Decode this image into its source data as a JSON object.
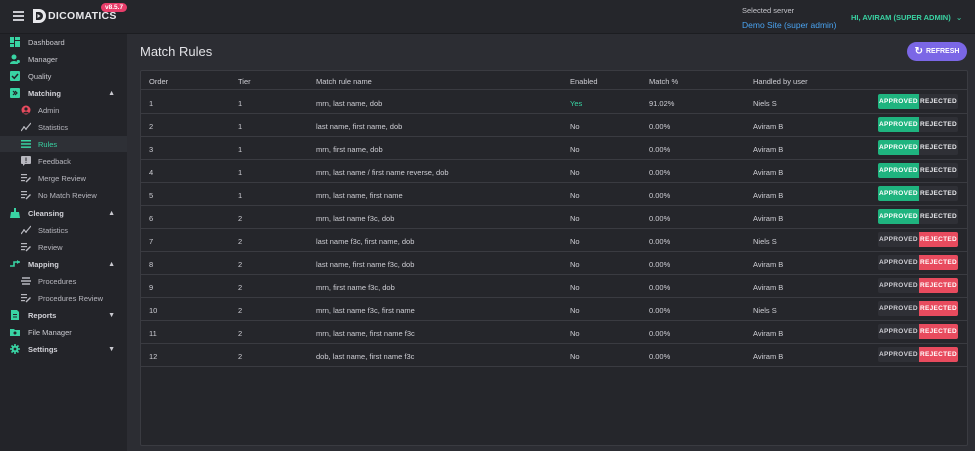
{
  "header": {
    "logo_text": "DICOMATICS",
    "version": "v8.5.7",
    "server_caption": "Selected server",
    "server_name": "Demo Site (super admin)",
    "user_greeting": "HI, AVIRAM (SUPER ADMIN)"
  },
  "sidebar": {
    "items": [
      {
        "label": "Dashboard",
        "icon": "dashboard-icon"
      },
      {
        "label": "Manager",
        "icon": "manager-icon"
      },
      {
        "label": "Quality",
        "icon": "quality-icon"
      },
      {
        "label": "Matching",
        "icon": "matching-icon",
        "expanded": true
      },
      {
        "label": "Admin",
        "icon": "admin-icon"
      },
      {
        "label": "Statistics",
        "icon": "statistics-icon"
      },
      {
        "label": "Rules",
        "icon": "rules-icon",
        "active": true
      },
      {
        "label": "Feedback",
        "icon": "feedback-icon"
      },
      {
        "label": "Merge Review",
        "icon": "review-icon"
      },
      {
        "label": "No Match Review",
        "icon": "review-icon"
      },
      {
        "label": "Cleansing",
        "icon": "cleansing-icon",
        "expanded": true
      },
      {
        "label": "Statistics",
        "icon": "statistics-icon"
      },
      {
        "label": "Review",
        "icon": "review-icon"
      },
      {
        "label": "Mapping",
        "icon": "mapping-icon",
        "expanded": true
      },
      {
        "label": "Procedures",
        "icon": "procedures-icon"
      },
      {
        "label": "Procedures Review",
        "icon": "review-icon"
      },
      {
        "label": "Reports",
        "icon": "reports-icon",
        "expanded": false
      },
      {
        "label": "File Manager",
        "icon": "file-manager-icon"
      },
      {
        "label": "Settings",
        "icon": "settings-icon",
        "expanded": false
      }
    ]
  },
  "main": {
    "title": "Match Rules",
    "refresh_label": "REFRESH",
    "columns": [
      "Order",
      "Tier",
      "Match rule name",
      "Enabled",
      "Match %",
      "Handled by user"
    ],
    "approve_label": "APPROVED",
    "reject_label": "REJECTED",
    "rows": [
      {
        "order": "1",
        "tier": "1",
        "name": "mrn, last name, dob",
        "enabled": "Yes",
        "match": "91.02%",
        "user": "Niels S",
        "status": "approved"
      },
      {
        "order": "2",
        "tier": "1",
        "name": "last name, first name, dob",
        "enabled": "No",
        "match": "0.00%",
        "user": "Aviram B",
        "status": "approved"
      },
      {
        "order": "3",
        "tier": "1",
        "name": "mrn, first name, dob",
        "enabled": "No",
        "match": "0.00%",
        "user": "Aviram B",
        "status": "approved"
      },
      {
        "order": "4",
        "tier": "1",
        "name": "mrn, last name / first name reverse, dob",
        "enabled": "No",
        "match": "0.00%",
        "user": "Aviram B",
        "status": "approved"
      },
      {
        "order": "5",
        "tier": "1",
        "name": "mrn, last name, first name",
        "enabled": "No",
        "match": "0.00%",
        "user": "Aviram B",
        "status": "approved"
      },
      {
        "order": "6",
        "tier": "2",
        "name": "mrn, last name f3c, dob",
        "enabled": "No",
        "match": "0.00%",
        "user": "Aviram B",
        "status": "approved"
      },
      {
        "order": "7",
        "tier": "2",
        "name": "last name f3c, first name, dob",
        "enabled": "No",
        "match": "0.00%",
        "user": "Niels S",
        "status": "rejected"
      },
      {
        "order": "8",
        "tier": "2",
        "name": "last name, first name f3c, dob",
        "enabled": "No",
        "match": "0.00%",
        "user": "Aviram B",
        "status": "rejected"
      },
      {
        "order": "9",
        "tier": "2",
        "name": "mrn, first name f3c, dob",
        "enabled": "No",
        "match": "0.00%",
        "user": "Aviram B",
        "status": "rejected"
      },
      {
        "order": "10",
        "tier": "2",
        "name": "mrn, last name f3c, first name",
        "enabled": "No",
        "match": "0.00%",
        "user": "Niels S",
        "status": "rejected"
      },
      {
        "order": "11",
        "tier": "2",
        "name": "mrn, last name, first name f3c",
        "enabled": "No",
        "match": "0.00%",
        "user": "Aviram B",
        "status": "rejected"
      },
      {
        "order": "12",
        "tier": "2",
        "name": "dob, last name, first name f3c",
        "enabled": "No",
        "match": "0.00%",
        "user": "Aviram B",
        "status": "rejected"
      }
    ]
  },
  "colors": {
    "accent": "#39d3a3",
    "approve": "#1fb47f",
    "reject": "#e84b5e",
    "refresh": "#7b67e6",
    "link": "#4aa3f0",
    "badge": "#e83d6a"
  }
}
